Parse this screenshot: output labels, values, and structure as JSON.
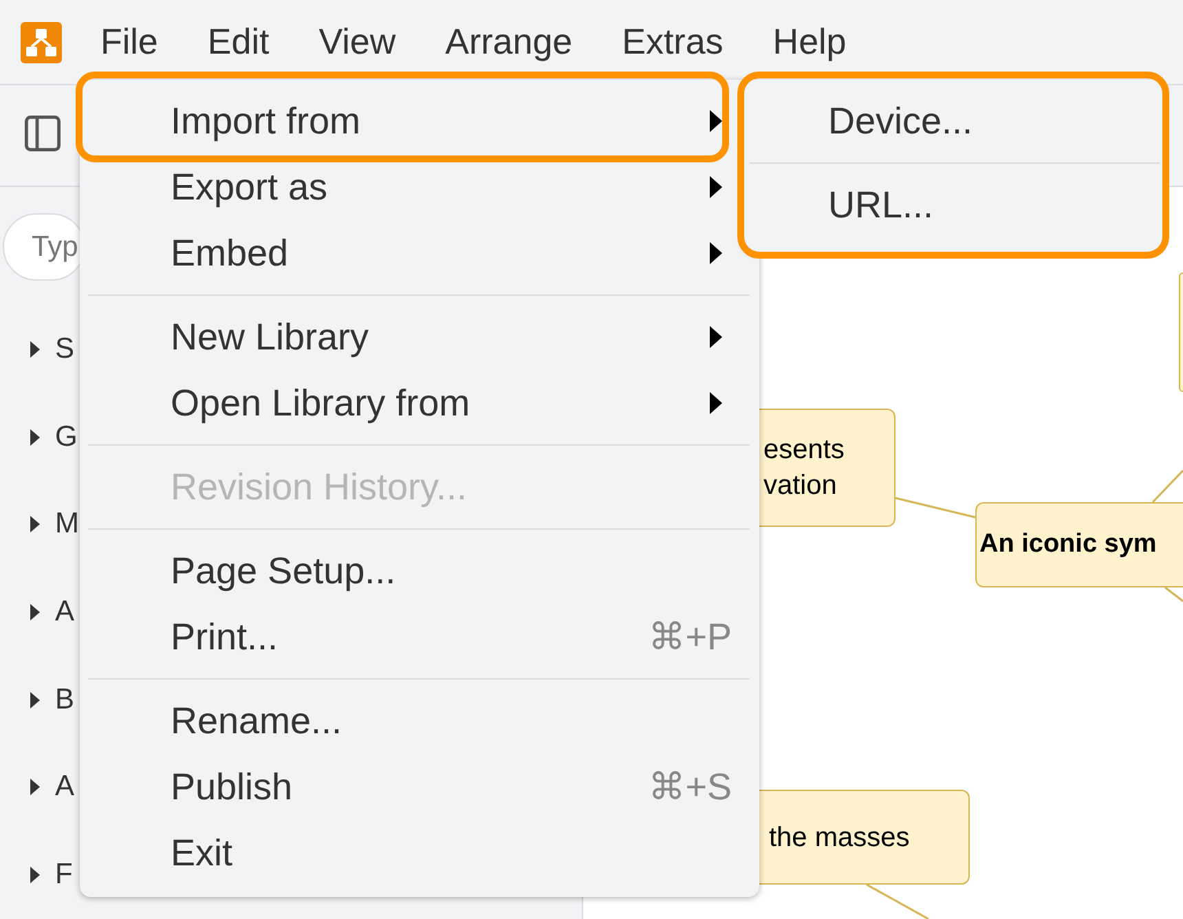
{
  "menubar": {
    "items": [
      "File",
      "Edit",
      "View",
      "Arrange",
      "Extras",
      "Help"
    ]
  },
  "sidebar": {
    "search": {
      "placeholder": "Typ"
    },
    "sections": [
      {
        "label": "S",
        "expanded": false
      },
      {
        "label": "G",
        "expanded": false
      },
      {
        "label": "M",
        "expanded": false
      },
      {
        "label": "A",
        "expanded": false
      },
      {
        "label": "B",
        "expanded": false
      },
      {
        "label": "A",
        "expanded": false
      },
      {
        "label": "F",
        "expanded": false
      }
    ]
  },
  "canvas": {
    "nodes": [
      {
        "kind": "topic"
      },
      {
        "kind": "topic",
        "text": "esents\nvation"
      },
      {
        "kind": "central",
        "text": "An iconic sym"
      },
      {
        "kind": "topic",
        "text": "the masses"
      }
    ]
  },
  "file_menu": {
    "items": [
      {
        "kind": "item",
        "label": "Import from",
        "has_submenu": true,
        "disabled": false,
        "highlighted": true,
        "submenu": {
          "highlighted": true,
          "items": [
            {
              "kind": "item",
              "label": "Device...",
              "disabled": false
            },
            {
              "kind": "separator"
            },
            {
              "kind": "item",
              "label": "URL...",
              "disabled": false
            }
          ]
        }
      },
      {
        "kind": "item",
        "label": "Export as",
        "has_submenu": true,
        "disabled": false,
        "highlighted": false
      },
      {
        "kind": "item",
        "label": "Embed",
        "has_submenu": true,
        "disabled": false,
        "highlighted": false
      },
      {
        "kind": "separator"
      },
      {
        "kind": "item",
        "label": "New Library",
        "has_submenu": true,
        "disabled": false,
        "highlighted": false
      },
      {
        "kind": "item",
        "label": "Open Library from",
        "has_submenu": true,
        "disabled": false,
        "highlighted": false
      },
      {
        "kind": "separator"
      },
      {
        "kind": "item",
        "label": "Revision History...",
        "has_submenu": false,
        "disabled": true,
        "highlighted": false
      },
      {
        "kind": "separator"
      },
      {
        "kind": "item",
        "label": "Page Setup...",
        "has_submenu": false,
        "disabled": false,
        "highlighted": false
      },
      {
        "kind": "item",
        "label": "Print...",
        "shortcut": "⌘+P",
        "has_submenu": false,
        "disabled": false,
        "highlighted": false
      },
      {
        "kind": "separator"
      },
      {
        "kind": "item",
        "label": "Rename...",
        "has_submenu": false,
        "disabled": false,
        "highlighted": false
      },
      {
        "kind": "item",
        "label": "Publish",
        "shortcut": "⌘+S",
        "has_submenu": false,
        "disabled": false,
        "highlighted": false
      },
      {
        "kind": "item",
        "label": "Exit",
        "has_submenu": false,
        "disabled": false,
        "highlighted": false
      }
    ]
  }
}
